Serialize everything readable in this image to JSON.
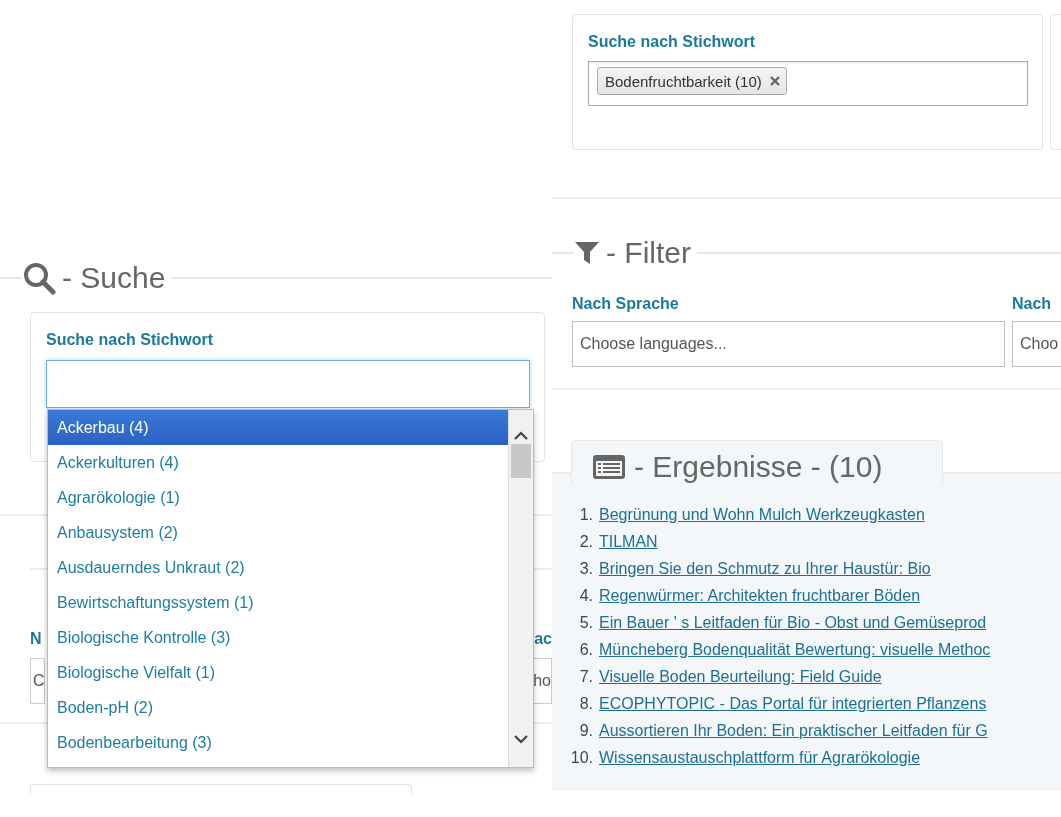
{
  "left_panel": {
    "search_section": {
      "title": "- Suche"
    },
    "keyword_card": {
      "label": "Suche nach Stichwort"
    },
    "dropdown": {
      "options": [
        {
          "label": "Ackerbau (4)",
          "selected": true
        },
        {
          "label": "Ackerkulturen (4)",
          "selected": false
        },
        {
          "label": "Agrarökologie (1)",
          "selected": false
        },
        {
          "label": "Anbausystem (2)",
          "selected": false
        },
        {
          "label": "Ausdauerndes Unkraut (2)",
          "selected": false
        },
        {
          "label": "Bewirtschaftungssystem (1)",
          "selected": false
        },
        {
          "label": "Biologische Kontrolle (3)",
          "selected": false
        },
        {
          "label": "Biologische Vielfalt (1)",
          "selected": false
        },
        {
          "label": "Boden-pH (2)",
          "selected": false
        },
        {
          "label": "Bodenbearbeitung (3)",
          "selected": false
        }
      ]
    },
    "filter_fragments": {
      "labels": [
        "N",
        "ac"
      ],
      "fields": [
        "C",
        "ho"
      ]
    }
  },
  "right_panel": {
    "keyword_card": {
      "label": "Suche nach Stichwort",
      "tags": [
        "Bodenfruchtbarkeit (10)"
      ]
    },
    "filter_section": {
      "title": "- Filter",
      "filters": [
        {
          "label": "Nach Sprache",
          "placeholder": "Choose languages..."
        },
        {
          "label": "Nach",
          "placeholder": "Choo"
        }
      ]
    },
    "results": {
      "title": "- Ergebnisse - (10)",
      "items": [
        {
          "number": "1.",
          "title": "Begrünung und Wohn Mulch Werkzeugkasten"
        },
        {
          "number": "2.",
          "title": "TILMAN"
        },
        {
          "number": "3.",
          "title": "Bringen Sie den Schmutz zu Ihrer Haustür: Bio"
        },
        {
          "number": "4.",
          "title": "Regenwürmer: Architekten fruchtbarer Böden"
        },
        {
          "number": "5.",
          "title": "Ein Bauer ' s Leitfaden für Bio - Obst und Gemüseprod"
        },
        {
          "number": "6.",
          "title": "Müncheberg Bodenqualität Bewertung: visuelle Methoc"
        },
        {
          "number": "7.",
          "title": "Visuelle Boden Beurteilung: Field Guide"
        },
        {
          "number": "8.",
          "title": "ECOPHYTOPIC - Das Portal für integrierten Pflanzens"
        },
        {
          "number": "9.",
          "title": "Aussortieren Ihr Boden: Ein praktischer Leitfaden für G"
        },
        {
          "number": "10.",
          "title": "Wissensaustauschplattform für Agrarökologie"
        }
      ]
    }
  }
}
